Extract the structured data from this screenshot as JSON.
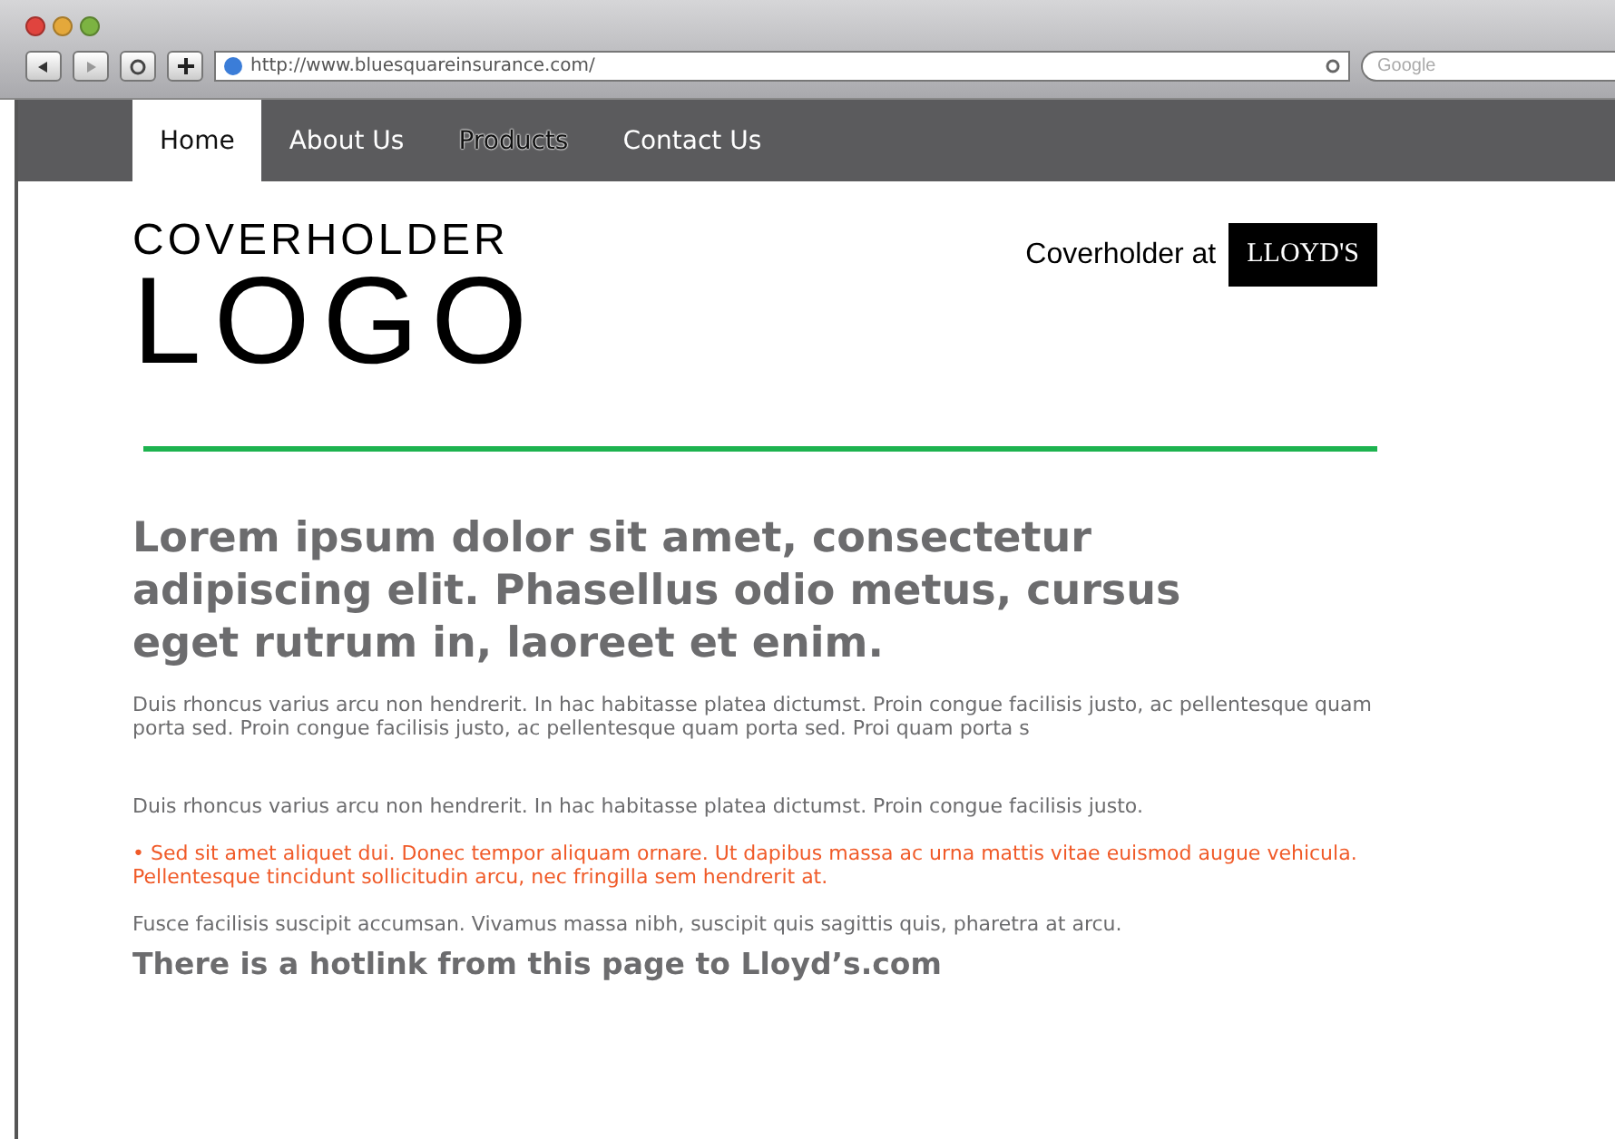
{
  "browser": {
    "url": "http://www.bluesquareinsurance.com/",
    "search": {
      "placeholder": "Google"
    }
  },
  "nav": [
    {
      "label": "Home",
      "selected": true,
      "outlined": false
    },
    {
      "label": "About Us",
      "selected": false,
      "outlined": false
    },
    {
      "label": "Products",
      "selected": false,
      "outlined": true
    },
    {
      "label": "Contact Us",
      "selected": false,
      "outlined": false
    }
  ],
  "logo": {
    "top": "COVERHOLDER",
    "bottom": "LOGO"
  },
  "badge": {
    "text": "Coverholder at",
    "mark": "LLOYD'S"
  },
  "headline": "Lorem ipsum dolor sit amet, consectetur adipiscing elit. Phasellus odio metus, cursus eget rutrum in, laoreet et enim.",
  "paragraphs": [
    {
      "kind": "text",
      "text": "Duis rhoncus varius arcu non hendrerit. In hac habitasse platea dictumst. Proin congue facilisis justo, ac pellentesque quam porta sed. Proin congue facilisis justo, ac pellentesque quam porta sed. Proi quam porta s"
    },
    {
      "kind": "text",
      "text": "Duis rhoncus varius arcu non hendrerit. In hac habitasse platea dictumst. Proin congue facilisis justo."
    },
    {
      "kind": "highlight",
      "text": "• Sed sit amet aliquet dui. Donec tempor aliquam ornare. Ut dapibus massa ac urna mattis vitae euismod augue vehicula. Pellentesque tincidunt sollicitudin arcu, nec fringilla sem hendrerit at."
    },
    {
      "kind": "text",
      "text": "Fusce facilisis suscipit accumsan. Vivamus massa nibh, suscipit quis sagittis quis, pharetra at arcu."
    },
    {
      "kind": "subhead",
      "text": "There is a hotlink from this page to Lloyd’s.com"
    }
  ]
}
